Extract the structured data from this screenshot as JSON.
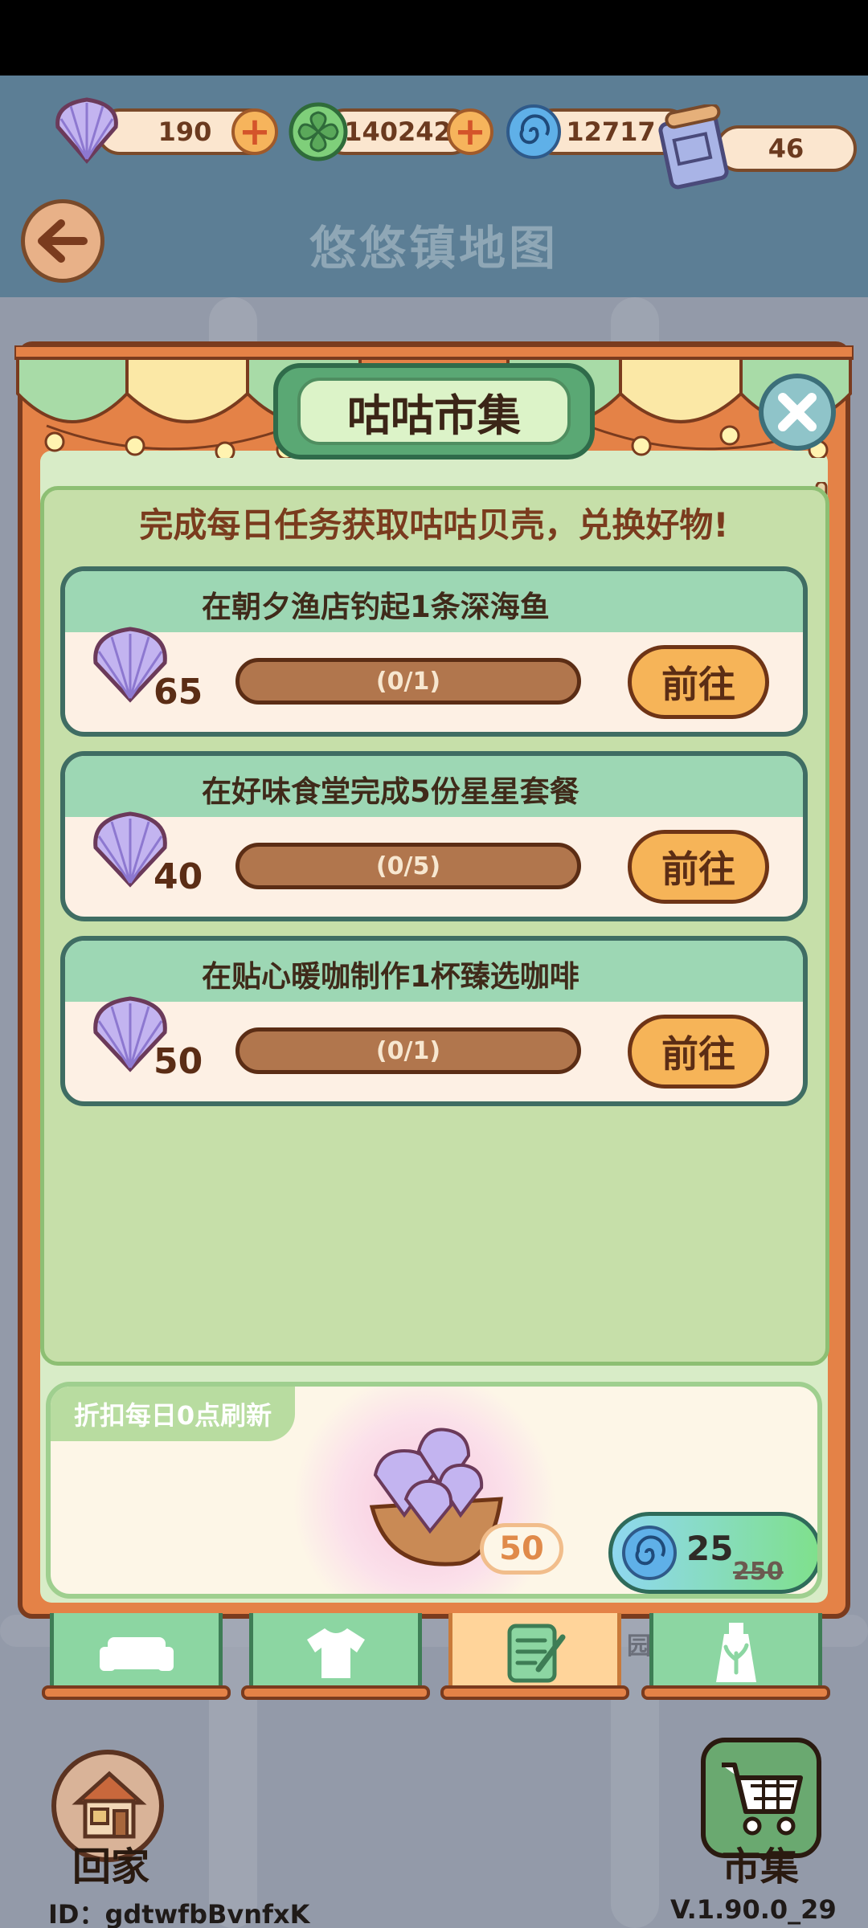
{
  "header": {
    "currencies": [
      {
        "icon": "shell-icon",
        "value": "190"
      },
      {
        "icon": "clover-icon",
        "value": "140242"
      },
      {
        "icon": "swirl-icon",
        "value": "12717"
      },
      {
        "icon": "scroll-map-icon",
        "value": "46"
      }
    ],
    "title": "悠悠镇地图"
  },
  "panel": {
    "title": "咕咕市集",
    "subtitle": "完成每日任务获取咕咕贝壳，兑换好物!",
    "tasks": [
      {
        "title": "在朝夕渔店钓起1条深海鱼",
        "reward": "65",
        "progress": "(0/1)",
        "button": "前往"
      },
      {
        "title": "在好味食堂完成5份星星套餐",
        "reward": "40",
        "progress": "(0/5)",
        "button": "前往"
      },
      {
        "title": "在贴心暖咖制作1杯臻选咖啡",
        "reward": "50",
        "progress": "(0/1)",
        "button": "前往"
      }
    ],
    "offer": {
      "tag": "折扣每日0点刷新",
      "item_count": "50",
      "price": "25",
      "original_price": "250"
    },
    "tabs": [
      {
        "icon": "sofa-icon",
        "active": false
      },
      {
        "icon": "shirt-icon",
        "active": false
      },
      {
        "icon": "task-list-icon",
        "active": true
      },
      {
        "icon": "sprout-bottle-icon",
        "active": false
      }
    ],
    "tab_badge": "园"
  },
  "bottom": {
    "home_label": "回家",
    "market_label": "市集",
    "user_id": "ID：gdtwfbBvnfxK",
    "version": "V.1.90.0_29"
  },
  "colors": {
    "accent_orange": "#e48247",
    "panel_green": "#c6dfa9",
    "button_yellow": "#f6b458",
    "shell_purple": "#b8a6e8"
  }
}
